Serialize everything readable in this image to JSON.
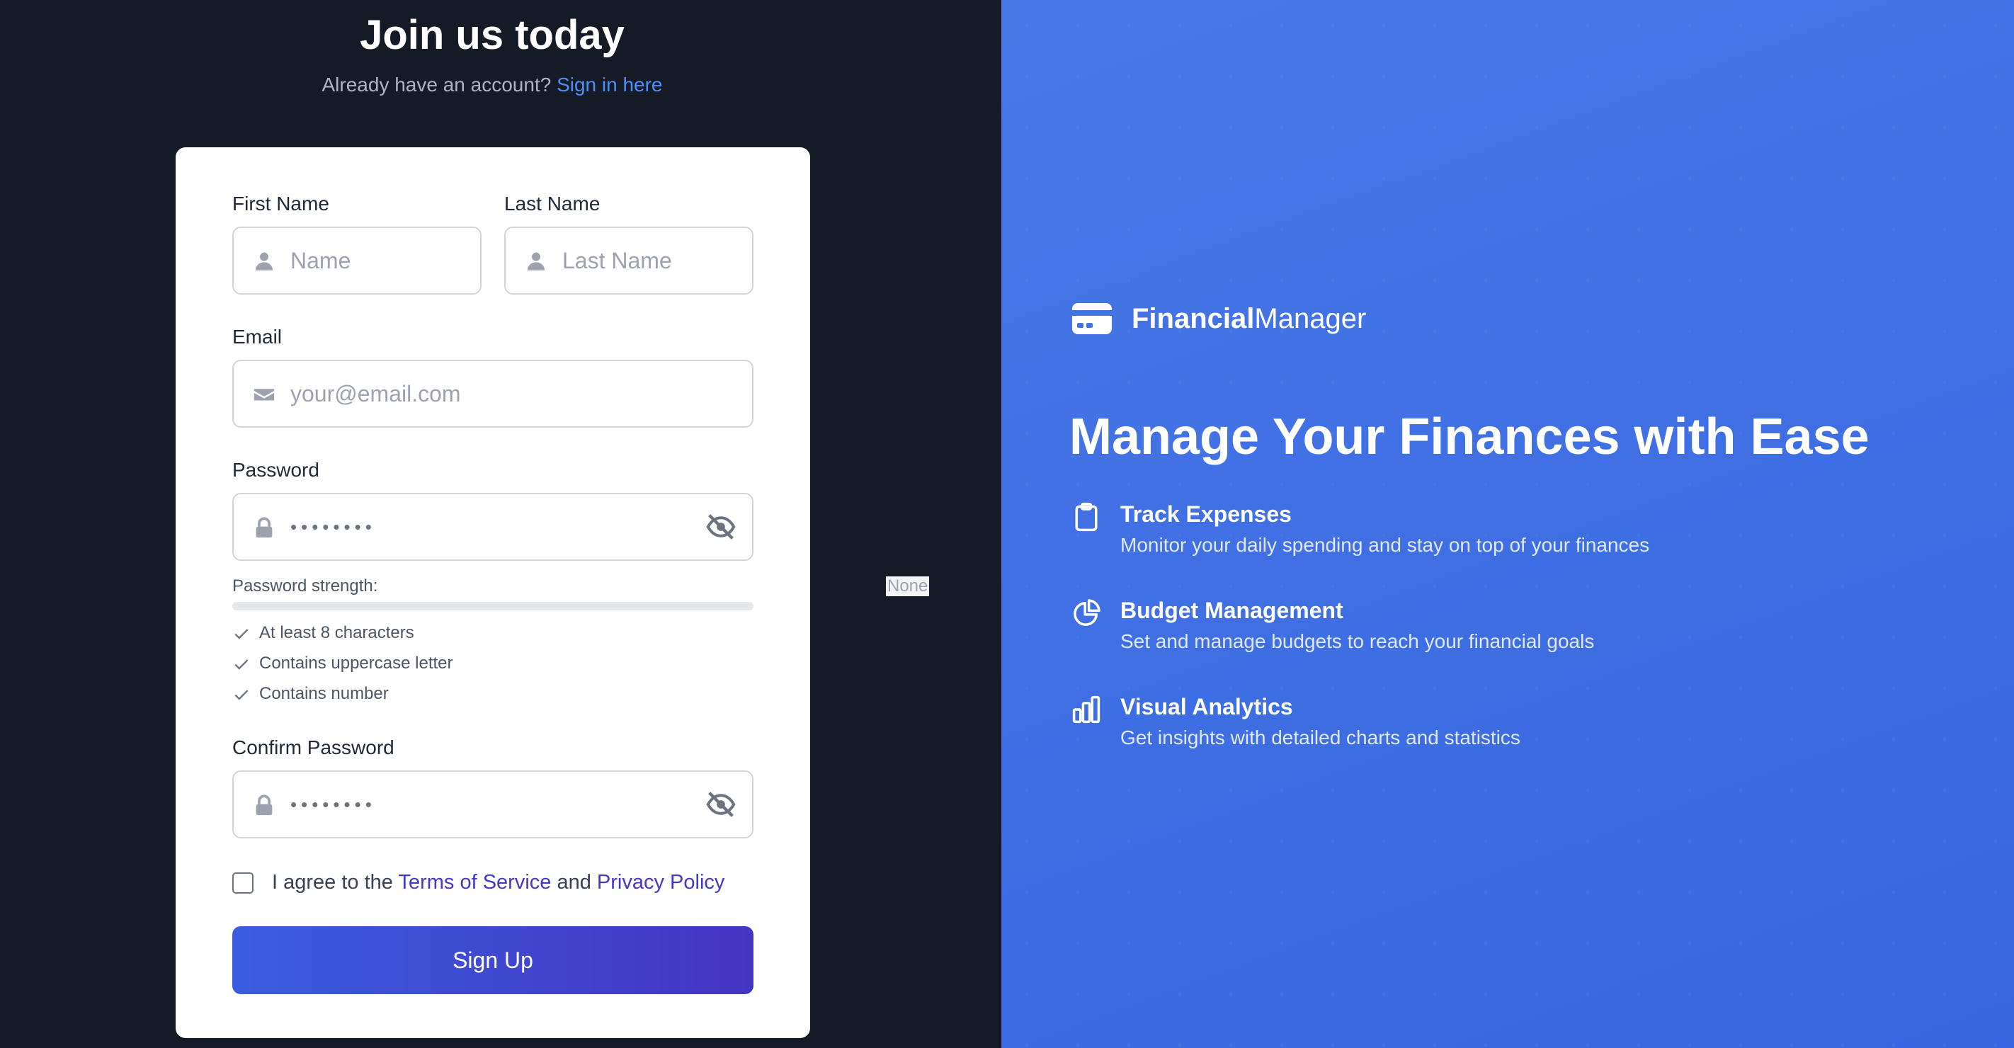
{
  "header": {
    "title": "Join us today",
    "subtitle_text": "Already have an account?",
    "signin_link": "Sign in here"
  },
  "form": {
    "first_name": {
      "label": "First Name",
      "placeholder": "Name",
      "icon": "user-icon"
    },
    "last_name": {
      "label": "Last Name",
      "placeholder": "Last Name",
      "icon": "user-icon"
    },
    "email": {
      "label": "Email",
      "placeholder": "your@email.com",
      "icon": "envelope-icon"
    },
    "password": {
      "label": "Password",
      "value": "••••••••",
      "icon": "lock-icon",
      "toggle_icon": "eye-slash-icon"
    },
    "strength": {
      "label": "Password strength:",
      "value": "None"
    },
    "requirements": [
      "At least 8 characters",
      "Contains uppercase letter",
      "Contains number"
    ],
    "confirm_password": {
      "label": "Confirm Password",
      "value": "••••••••",
      "icon": "lock-icon",
      "toggle_icon": "eye-slash-icon"
    },
    "agree": {
      "prefix": "I agree to the",
      "terms": "Terms of Service",
      "and": "and",
      "privacy": "Privacy Policy",
      "checked": false
    },
    "submit_label": "Sign Up"
  },
  "promo": {
    "brand_bold": "Financial",
    "brand_regular": "Manager",
    "brand_icon": "credit-card-icon",
    "headline": "Manage Your Finances with Ease",
    "features": [
      {
        "icon": "clipboard-icon",
        "title": "Track Expenses",
        "description": "Monitor your daily spending and stay on top of your finances"
      },
      {
        "icon": "pie-chart-icon",
        "title": "Budget Management",
        "description": "Set and manage budgets to reach your financial goals"
      },
      {
        "icon": "bar-chart-icon",
        "title": "Visual Analytics",
        "description": "Get insights with detailed charts and statistics"
      }
    ]
  },
  "colors": {
    "left_bg": "#141a26",
    "accent_link": "#4f8ff7",
    "legal_link": "#4338ca",
    "button_start": "#3a5de0",
    "button_end": "#4434c2",
    "right_bg": "#4272e4"
  }
}
